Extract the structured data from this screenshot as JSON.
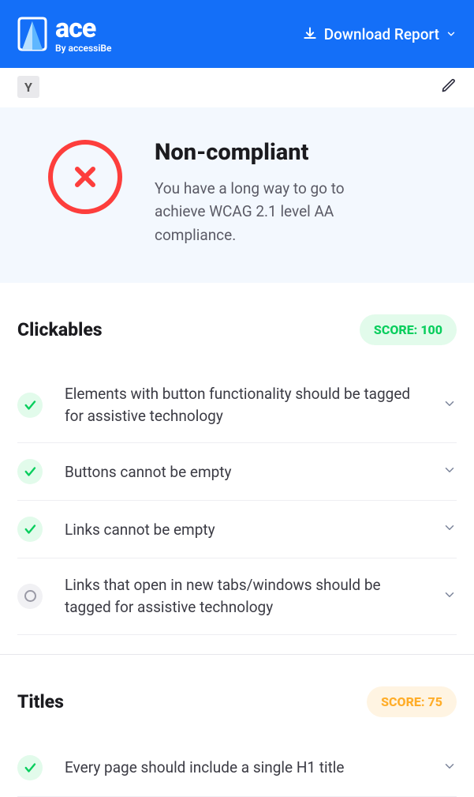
{
  "header": {
    "brand_main": "ace",
    "brand_sub": "By accessiBe",
    "download_label": "Download Report"
  },
  "toolbar": {
    "chip_label": "Y"
  },
  "status": {
    "title": "Non-compliant",
    "description": "You have a long way to go to achieve WCAG 2.1 level AA compliance."
  },
  "sections": [
    {
      "title": "Clickables",
      "score_label": "SCORE: 100",
      "score_variant": "green",
      "rules": [
        {
          "status": "pass",
          "text": "Elements with button functionality should be tagged for assistive technology"
        },
        {
          "status": "pass",
          "text": "Buttons cannot be empty"
        },
        {
          "status": "pass",
          "text": "Links cannot be empty"
        },
        {
          "status": "neutral",
          "text": "Links that open in new tabs/windows should be tagged for assistive technology"
        }
      ]
    },
    {
      "title": "Titles",
      "score_label": "SCORE: 75",
      "score_variant": "orange",
      "rules": [
        {
          "status": "pass",
          "text": "Every page should include a single H1 title"
        }
      ]
    }
  ]
}
